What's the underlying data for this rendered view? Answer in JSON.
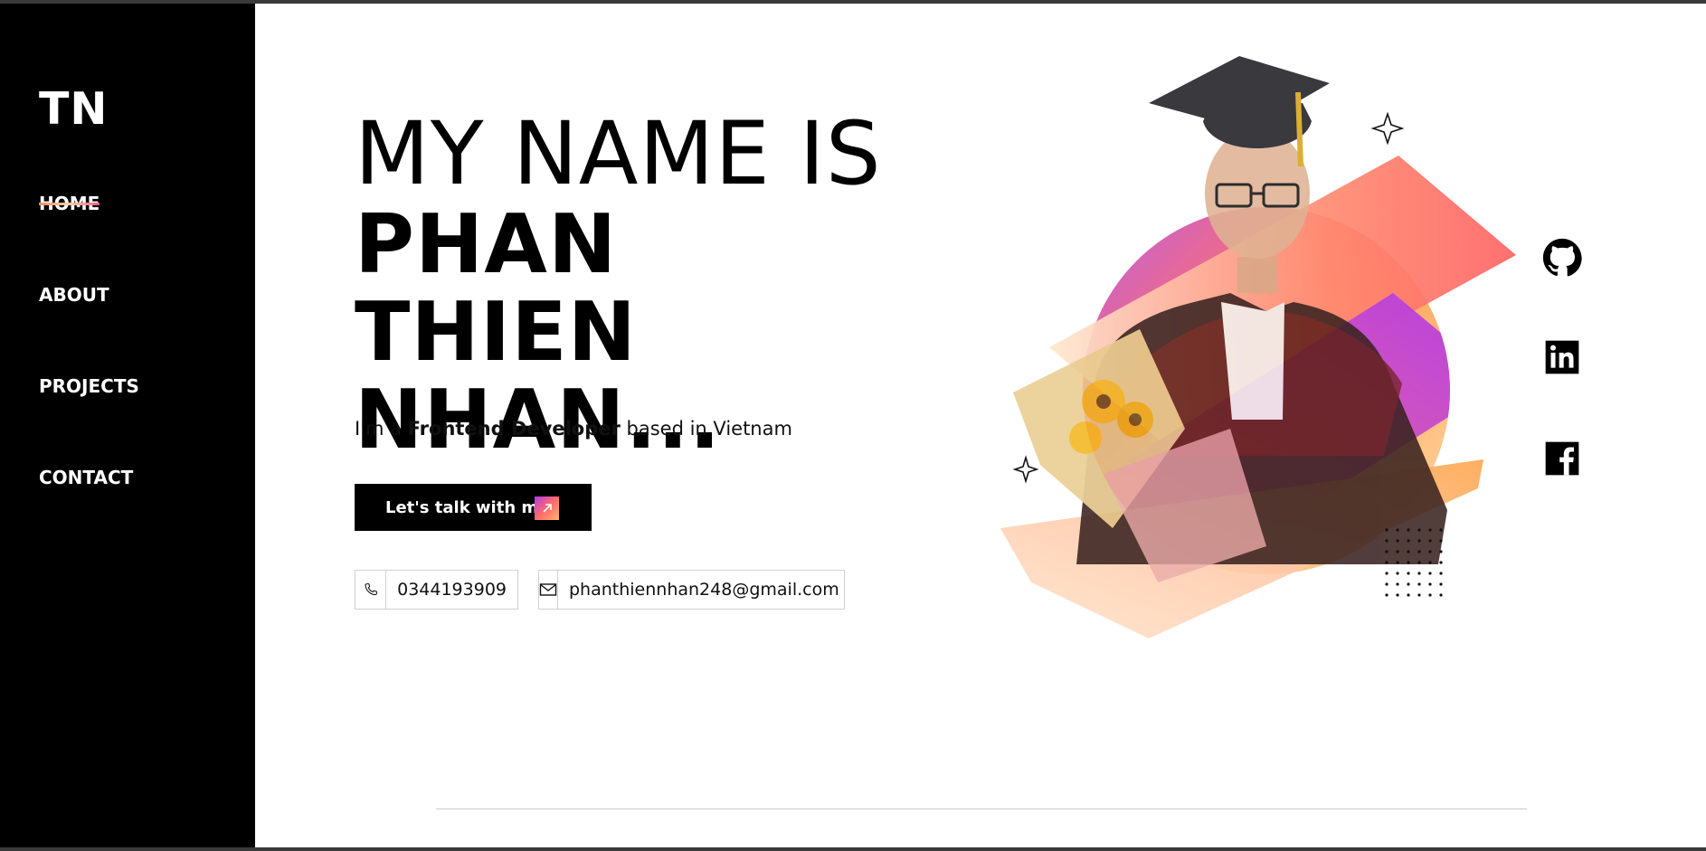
{
  "sidebar": {
    "logo": "TN",
    "nav": [
      {
        "label": "HOME",
        "active": true
      },
      {
        "label": "ABOUT"
      },
      {
        "label": "PROJECTS"
      },
      {
        "label": "CONTACT"
      }
    ]
  },
  "hero": {
    "intro": "MY NAME IS",
    "name_line1": "PHAN THIEN",
    "name_line2": "NHAN...",
    "tagline_prefix": "I'm a",
    "tagline_role": "Frontend Developer",
    "tagline_suffix": "based in Vietnam",
    "cta_label": "Let's talk with me"
  },
  "contact": {
    "phone": "0344193909",
    "email": "phanthiennhan248@gmail.com"
  },
  "socials": [
    {
      "name": "github",
      "icon": "github-icon"
    },
    {
      "name": "linkedin",
      "icon": "linkedin-icon"
    },
    {
      "name": "facebook",
      "icon": "facebook-icon"
    }
  ],
  "colors": {
    "gradient_purple": "#b23ce8",
    "gradient_coral": "#ff6a6a",
    "gradient_orange": "#ffb46a",
    "sidebar_bg": "#000000"
  }
}
